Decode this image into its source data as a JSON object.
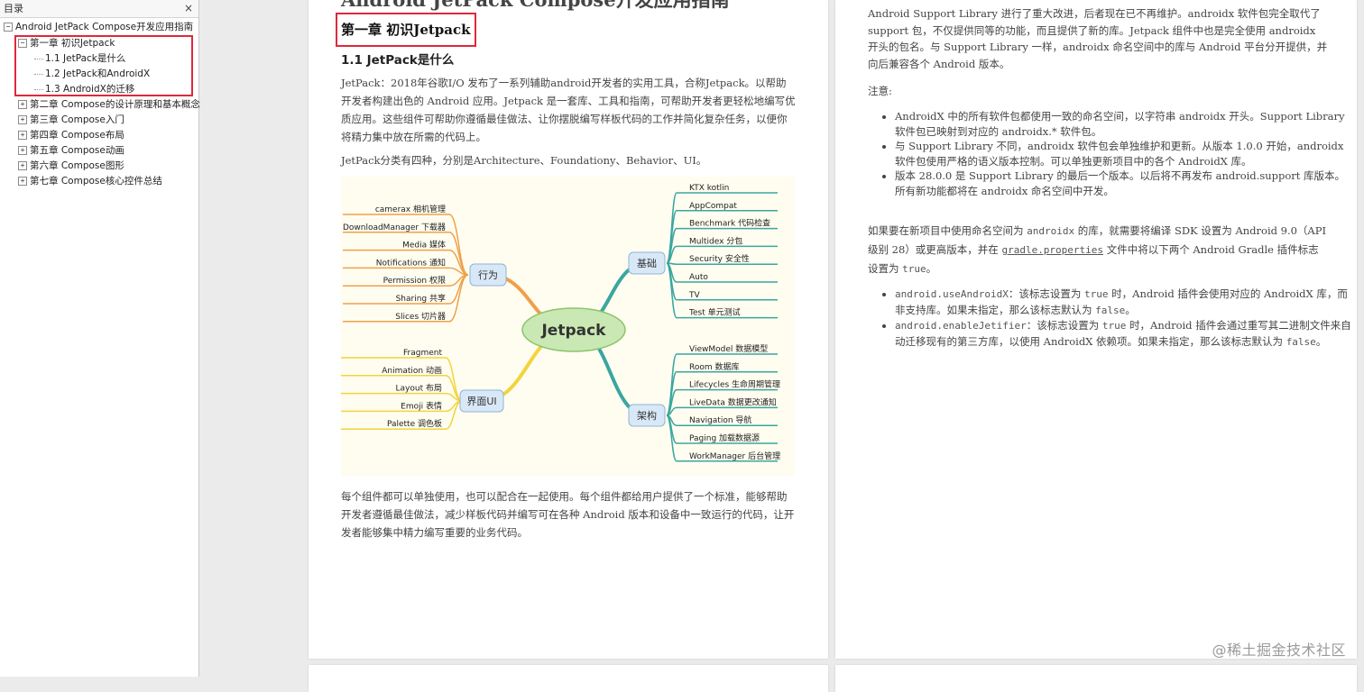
{
  "sidebar": {
    "header": "目录",
    "close": "×",
    "root": "Android JetPack Compose开发应用指南",
    "items": [
      {
        "label": "第一章 初识Jetpack",
        "toggle": "−"
      },
      {
        "label": "1.1 JetPack是什么"
      },
      {
        "label": "1.2 JetPack和AndroidX"
      },
      {
        "label": "1.3 AndroidX的迁移"
      },
      {
        "label": "第二章 Compose的设计原理和基本概念",
        "toggle": "+"
      },
      {
        "label": "第三章 Compose入门",
        "toggle": "+"
      },
      {
        "label": "第四章 Compose布局",
        "toggle": "+"
      },
      {
        "label": "第五章 Compose动画",
        "toggle": "+"
      },
      {
        "label": "第六章 Compose图形",
        "toggle": "+"
      },
      {
        "label": "第七章 Compose核心控件总结",
        "toggle": "+"
      }
    ],
    "root_toggle": "−"
  },
  "left_page": {
    "cut_title": "Android JetPack Compose开发应用指南",
    "chapter_title": "第一章 初识Jetpack",
    "section_title": "1.1 JetPack是什么",
    "para1": "JetPack：2018年谷歌I/O 发布了一系列辅助android开发者的实用工具，合称Jetpack。以帮助开发者构建出色的 Android 应用。Jetpack 是一套库、工具和指南，可帮助开发者更轻松地编写优质应用。这些组件可帮助你遵循最佳做法、让你摆脱编写样板代码的工作并简化复杂任务，以便你将精力集中放在所需的代码上。",
    "para2": "JetPack分类有四种，分别是Architecture、Foundationy、Behavior、UI。",
    "para3": "每个组件都可以单独使用，也可以配合在一起使用。每个组件都给用户提供了一个标准，能够帮助开发者遵循最佳做法，减少样板代码并编写可在各种 Android 版本和设备中一致运行的代码，让开发者能够集中精力编写重要的业务代码。"
  },
  "mindmap": {
    "center": "Jetpack",
    "branches": [
      {
        "name": "行为",
        "color": "#f0a04a",
        "side": "left",
        "items": [
          "camerax 相机管理",
          "DownloadManager 下载器",
          "Media 媒体",
          "Notifications 通知",
          "Permission 权限",
          "Sharing 共享",
          "Slices 切片器"
        ]
      },
      {
        "name": "界面UI",
        "color": "#f2d43c",
        "side": "left",
        "items": [
          "Fragment",
          "Animation 动画",
          "Layout 布局",
          "Emoji 表情",
          "Palette 调色板"
        ]
      },
      {
        "name": "基础",
        "color": "#3aa6a0",
        "side": "right",
        "items": [
          "KTX kotlin",
          "AppCompat",
          "Benchmark 代码检查",
          "Multidex 分包",
          "Security 安全性",
          "Auto",
          "TV",
          "Test 单元测试"
        ]
      },
      {
        "name": "架构",
        "color": "#3aa6a0",
        "side": "right",
        "items": [
          "ViewModel 数据模型",
          "Room 数据库",
          "Lifecycles 生命周期管理",
          "LiveData 数据更改通知",
          "Navigation 导航",
          "Paging 加载数据源",
          "WorkManager 后台管理"
        ]
      }
    ]
  },
  "right_page": {
    "top_para": "Android Support Library 进行了重大改进，后者现在已不再维护。androidx 软件包完全取代了 support 包，不仅提供同等的功能，而且提供了新的库。Jetpack 组件中也是完全使用 androidx 开头的包名。与 Support Library 一样，androidx 命名空间中的库与 Android 平台分开提供，并向后兼容各个 Android 版本。",
    "note_label": "注意:",
    "notes": [
      "AndroidX 中的所有软件包都使用一致的命名空间，以字符串 androidx 开头。Support Library 软件包已映射到对应的 androidx.* 软件包。",
      "与 Support Library 不同，androidx 软件包会单独维护和更新。从版本 1.0.0 开始，androidx 软件包使用严格的语义版本控制。可以单独更新项目中的各个 AndroidX 库。",
      "版本 28.0.0 是 Support Library 的最后一个版本。以后将不再发布 android.support 库版本。所有新功能都将在 androidx 命名空间中开发。"
    ],
    "mid_a": "如果要在新项目中使用命名空间为 ",
    "mid_code1": "androidx",
    "mid_b": " 的库，就需要将编译 SDK 设置为 Android 9.0（API 级别 28）或更高版本，并在 ",
    "mid_link": "gradle.properties",
    "mid_c": " 文件中将以下两个 Android Gradle 插件标志设置为 ",
    "mid_code2": "true",
    "mid_d": "。",
    "flags": [
      {
        "code": "android.useAndroidX",
        "a": "：该标志设置为 ",
        "t": "true",
        "b": " 时，Android 插件会使用对应的 AndroidX 库，而非支持库。如果未指定，那么该标志默认为 ",
        "f": "false",
        "c": "。"
      },
      {
        "code": "android.enableJetifier",
        "a": "：该标志设置为 ",
        "t": "true",
        "b": " 时，Android 插件会通过重写其二进制文件来自动迁移现有的第三方库，以使用 AndroidX 依赖项。如果未指定，那么该标志默认为 ",
        "f": "false",
        "c": "。"
      }
    ]
  },
  "watermark": "@稀土掘金技术社区",
  "colors": {
    "highlight": "#e0283a",
    "background": "#ebebeb"
  }
}
